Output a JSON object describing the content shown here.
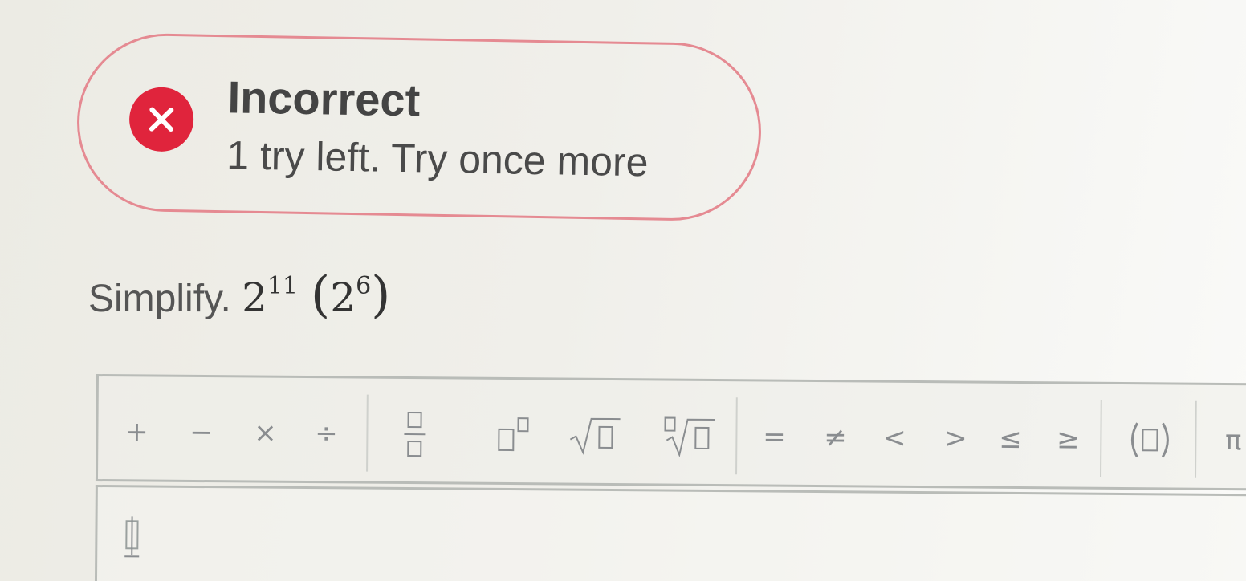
{
  "feedback": {
    "title": "Incorrect",
    "message": "1 try left. Try once more",
    "icon": "error-x-icon",
    "colors": {
      "icon_bg": "#e0243c",
      "border": "#e58a92"
    }
  },
  "question": {
    "prompt": "Simplify.",
    "base1": "2",
    "exp1": "11",
    "open_paren": "(",
    "base2": "2",
    "exp2": "6",
    "close_paren": ")"
  },
  "toolbar": {
    "plus": "+",
    "minus": "−",
    "times": "×",
    "divide": "÷",
    "fraction": "fraction-template-icon",
    "exponent": "exponent-template-icon",
    "sqrt": "square-root-template-icon",
    "nth_root": "nth-root-template-icon",
    "equals": "=",
    "not_equal": "≠",
    "less": "<",
    "greater": ">",
    "less_equal": "≤",
    "greater_equal": "≥",
    "parentheses": "parentheses-template-icon",
    "pi": "π"
  },
  "answer": {
    "value": "",
    "cursor": "text-cursor-icon"
  }
}
